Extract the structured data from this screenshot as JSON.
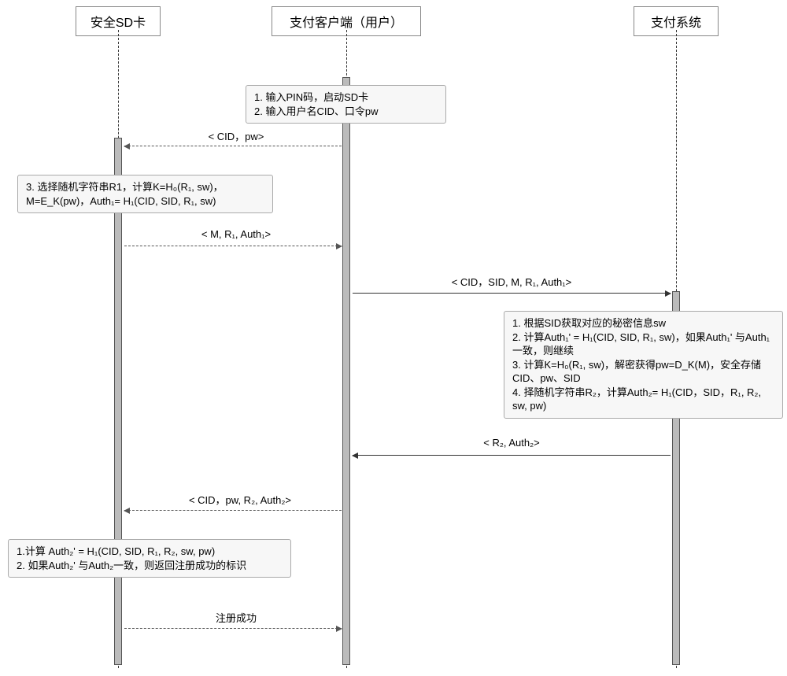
{
  "lifelines": {
    "sd": "安全SD卡",
    "client": "支付客户端（用户）",
    "system": "支付系统"
  },
  "boxes": {
    "step1": "1. 输入PIN码，启动SD卡\n2. 输入用户名CID、口令pw",
    "step3": "3. 选择随机字符串R1，计算K=H₀(R₁, sw)，\nM=E_K(pw)，Auth₁= H₁(CID, SID, R₁, sw)",
    "server_steps": "1. 根据SID获取对应的秘密信息sw\n2. 计算Auth₁' = H₁(CID, SID, R₁, sw)，如果Auth₁' 与Auth₁一致，则继续\n3. 计算K=H₀(R₁, sw)，解密获得pw=D_K(M)，安全存储CID、pw、SID\n4. 择随机字符串R₂，计算Auth₂= H₁(CID，SID，R₁, R₂, sw, pw)",
    "verify": "1.计算 Auth₂' = H₁(CID, SID, R₁, R₂, sw, pw)\n2. 如果Auth₂' 与Auth₂一致，则返回注册成功的标识"
  },
  "messages": {
    "m1": "< CID，pw>",
    "m2": "< M, R₁, Auth₁>",
    "m3": "< CID，SID, M, R₁, Auth₁>",
    "m4": "< R₂, Auth₂>",
    "m5": "< CID，pw, R₂, Auth₂>",
    "m6": "注册成功"
  }
}
